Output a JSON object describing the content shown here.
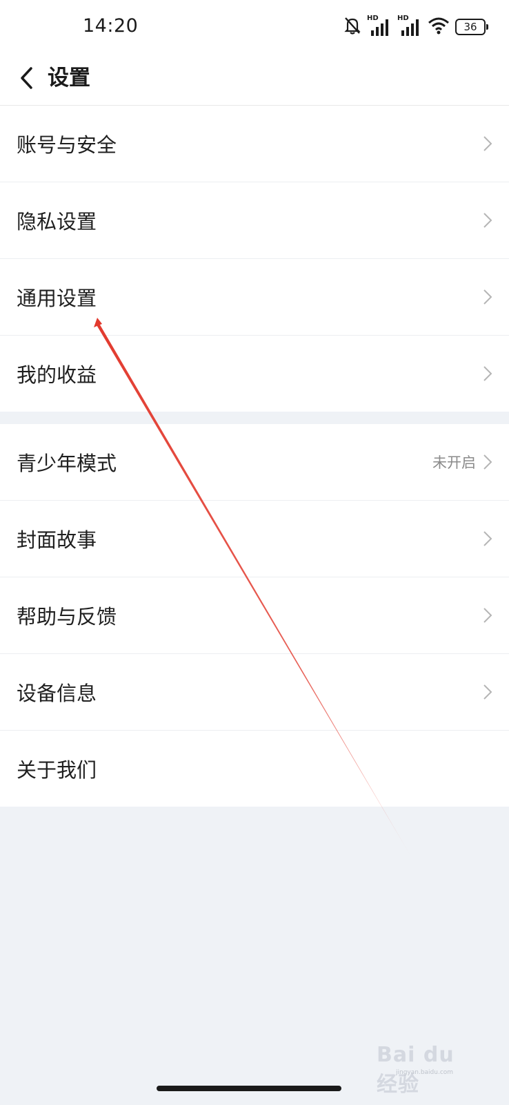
{
  "status_bar": {
    "time": "14:20",
    "signal_label_1": "HD",
    "signal_label_2": "HD",
    "battery": "36",
    "icons": [
      "bell-muted-icon",
      "signal-icon",
      "signal-icon",
      "wifi-icon",
      "battery-icon"
    ]
  },
  "header": {
    "back_icon": "chevron-left-icon",
    "title": "设置"
  },
  "groups": [
    {
      "items": [
        {
          "label": "账号与安全",
          "chevron": true
        },
        {
          "label": "隐私设置",
          "chevron": true
        },
        {
          "label": "通用设置",
          "chevron": true
        },
        {
          "label": "我的收益",
          "chevron": true
        }
      ]
    },
    {
      "items": [
        {
          "label": "青少年模式",
          "value": "未开启",
          "chevron": true
        },
        {
          "label": "封面故事",
          "chevron": true
        },
        {
          "label": "帮助与反馈",
          "chevron": true
        },
        {
          "label": "设备信息",
          "chevron": true
        },
        {
          "label": "关于我们",
          "chevron": false
        }
      ]
    }
  ],
  "annotation": {
    "arrow_color": "#e23a2e",
    "points_to": "通用设置"
  },
  "watermark": {
    "text": "Bai du 经验",
    "sub": "jingyan.baidu.com"
  },
  "colors": {
    "background": "#eff2f6",
    "row_background": "#ffffff",
    "secondary_text": "#8a8a8a",
    "chevron": "#b5b5b5"
  }
}
